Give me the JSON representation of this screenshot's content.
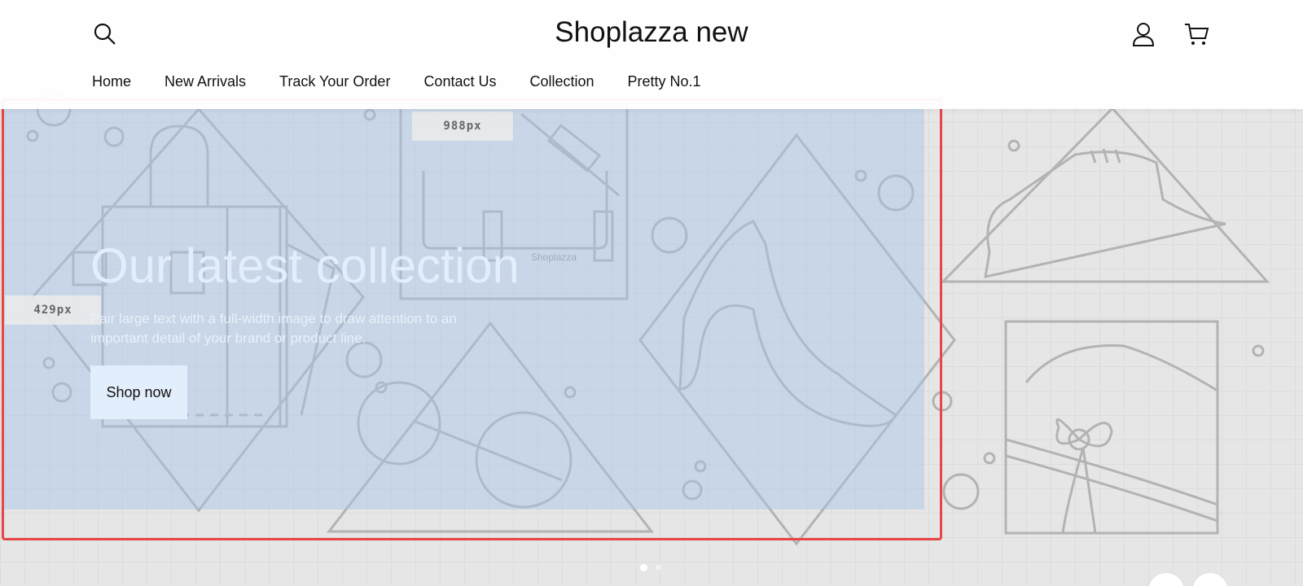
{
  "header": {
    "brand": "Shoplazza new",
    "icons": {
      "search": "search-icon",
      "account": "user-icon",
      "cart": "cart-icon"
    },
    "nav": [
      "Home",
      "New Arrivals",
      "Track Your Order",
      "Contact Us",
      "Collection",
      "Pretty No.1"
    ]
  },
  "hero": {
    "title": "Our latest collection",
    "subtitle": "Pair large text with a full-width image to draw attention to an important detail of your brand or product line.",
    "button": "Shop now",
    "illustration_text": "Shoplazza"
  },
  "editor": {
    "width_label": "988px",
    "height_label": "429px",
    "selection_color": "#e84545",
    "overlay_color": "#a3c4e8"
  },
  "slider": {
    "active_index": 0,
    "count": 2
  }
}
